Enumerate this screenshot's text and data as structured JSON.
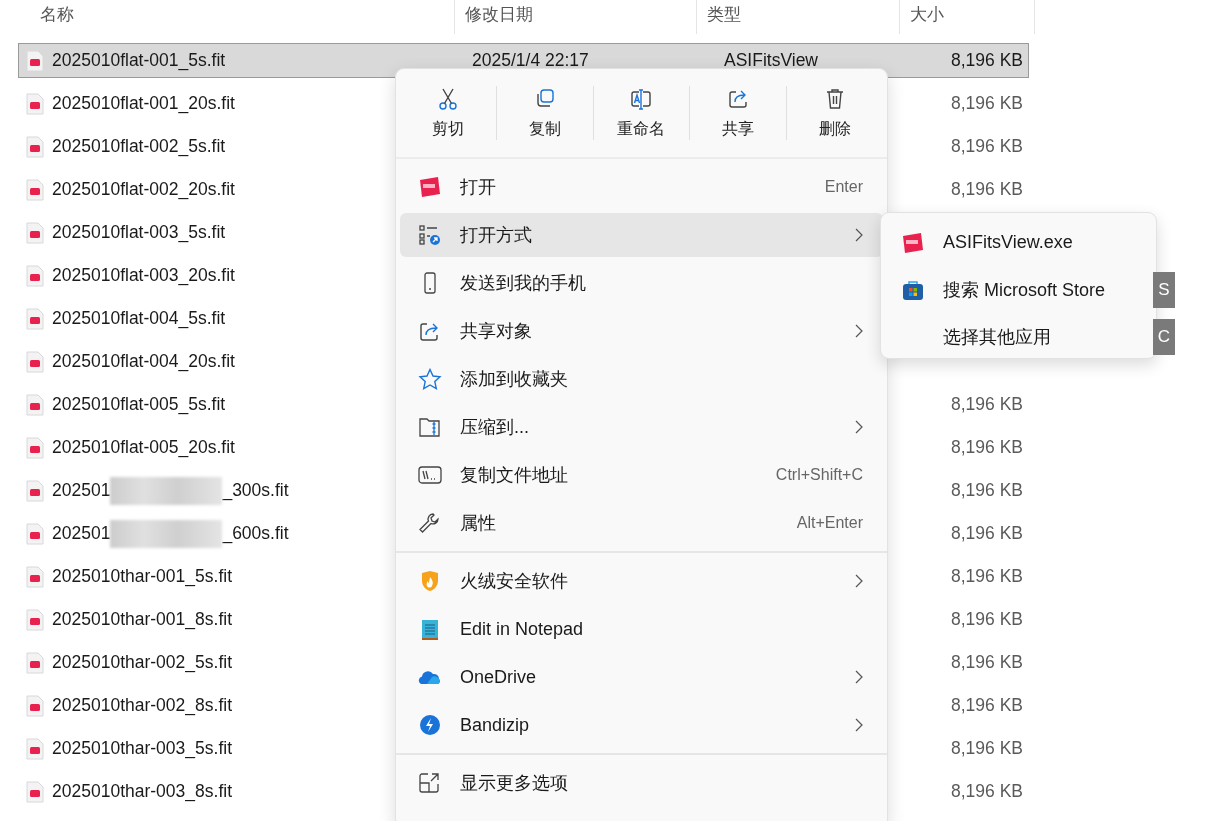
{
  "columns": [
    "名称",
    "修改日期",
    "类型",
    "大小"
  ],
  "files": [
    {
      "name": "2025010flat-001_5s.fit",
      "date": "2025/1/4 22:17",
      "type": "ASIFitsView",
      "size": "8,196 KB",
      "selected": true
    },
    {
      "name": "2025010flat-001_20s.fit",
      "size": "8,196 KB",
      "selected": false
    },
    {
      "name": "2025010flat-002_5s.fit",
      "size": "8,196 KB",
      "selected": false
    },
    {
      "name": "2025010flat-002_20s.fit",
      "size": "8,196 KB",
      "selected": false
    },
    {
      "name": "2025010flat-003_5s.fit",
      "selected": false
    },
    {
      "name": "2025010flat-003_20s.fit",
      "selected": false
    },
    {
      "name": "2025010flat-004_5s.fit",
      "selected": false
    },
    {
      "name": "2025010flat-004_20s.fit",
      "selected": false
    },
    {
      "name": "2025010flat-005_5s.fit",
      "size": "8,196 KB",
      "selected": false
    },
    {
      "name": "2025010flat-005_20s.fit",
      "size": "8,196 KB",
      "selected": false
    },
    {
      "name": "202501",
      "name_end": "_300s.fit",
      "redacted": true,
      "size": "8,196 KB",
      "selected": false
    },
    {
      "name": "202501",
      "name_end": "_600s.fit",
      "redacted": true,
      "size": "8,196 KB",
      "selected": false
    },
    {
      "name": "2025010thar-001_5s.fit",
      "size": "8,196 KB",
      "selected": false
    },
    {
      "name": "2025010thar-001_8s.fit",
      "size": "8,196 KB",
      "selected": false
    },
    {
      "name": "2025010thar-002_5s.fit",
      "size": "8,196 KB",
      "selected": false
    },
    {
      "name": "2025010thar-002_8s.fit",
      "size": "8,196 KB",
      "selected": false
    },
    {
      "name": "2025010thar-003_5s.fit",
      "size": "8,196 KB",
      "selected": false
    },
    {
      "name": "2025010thar-003_8s.fit",
      "size": "8,196 KB",
      "selected": false
    }
  ],
  "context_menu": {
    "toolbar": [
      {
        "label": "剪切"
      },
      {
        "label": "复制"
      },
      {
        "label": "重命名"
      },
      {
        "label": "共享"
      },
      {
        "label": "删除"
      }
    ],
    "groups": [
      [
        {
          "label": "打开",
          "shortcut": "Enter",
          "submenu": false,
          "selected": false
        },
        {
          "label": "打开方式",
          "submenu": true,
          "selected": true
        },
        {
          "label": "发送到我的手机",
          "submenu": false,
          "selected": false
        },
        {
          "label": "共享对象",
          "submenu": true,
          "selected": false
        },
        {
          "label": "添加到收藏夹",
          "submenu": false,
          "selected": false
        },
        {
          "label": "压缩到...",
          "submenu": true,
          "selected": false
        },
        {
          "label": "复制文件地址",
          "shortcut": "Ctrl+Shift+C",
          "submenu": false,
          "selected": false
        },
        {
          "label": "属性",
          "shortcut": "Alt+Enter",
          "submenu": false,
          "selected": false
        }
      ],
      [
        {
          "label": "火绒安全软件",
          "submenu": true,
          "selected": false
        },
        {
          "label": "Edit in Notepad",
          "submenu": false,
          "selected": false
        },
        {
          "label": "OneDrive",
          "submenu": true,
          "selected": false
        },
        {
          "label": "Bandizip",
          "submenu": true,
          "selected": false
        }
      ],
      [
        {
          "label": "显示更多选项",
          "submenu": false,
          "selected": false
        }
      ]
    ]
  },
  "submenu": [
    {
      "label": "ASIFitsView.exe"
    },
    {
      "label": "搜索 Microsoft Store",
      "access_key": "S"
    },
    {
      "label": "选择其他应用",
      "access_key": "C"
    }
  ]
}
